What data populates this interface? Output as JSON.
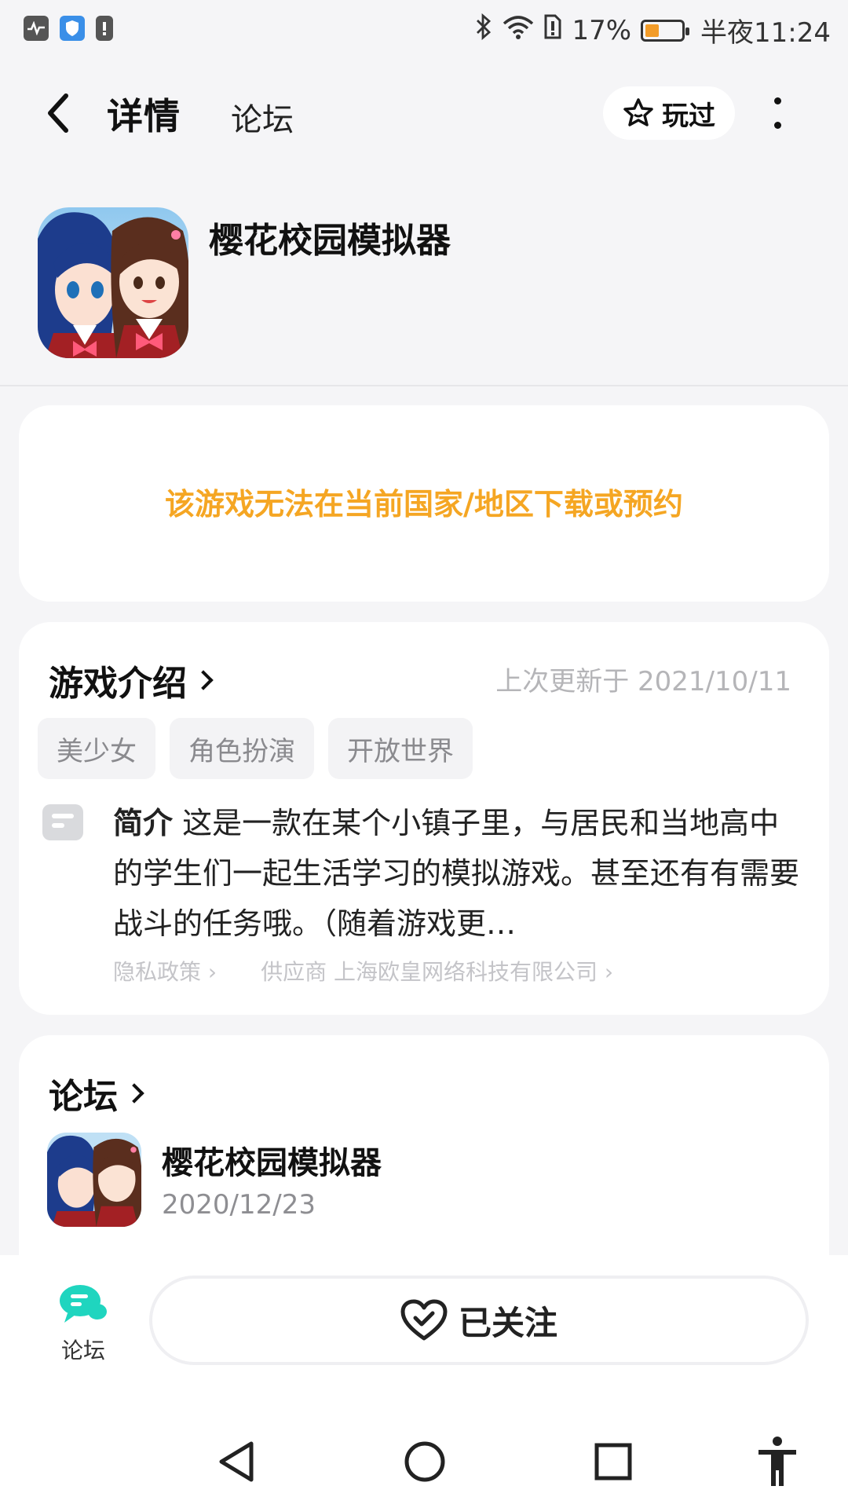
{
  "status_bar": {
    "battery_percent": "17%",
    "time": "半夜11:24",
    "icons": [
      "activity-monitor-icon",
      "shield-icon",
      "alert-icon",
      "bluetooth-icon",
      "wifi-icon",
      "sim-alert-icon",
      "battery-icon"
    ],
    "battery_level": 0.34
  },
  "header": {
    "tabs": [
      {
        "label": "详情",
        "active": true
      },
      {
        "label": "论坛",
        "active": false
      }
    ],
    "played_label": "玩过"
  },
  "app": {
    "title": "樱花校园模拟器"
  },
  "notice": {
    "text": "该游戏无法在当前国家/地区下载或预约",
    "color": "#f5a623"
  },
  "intro": {
    "title": "游戏介绍",
    "updated": "上次更新于 2021/10/11",
    "tags": [
      "美少女",
      "角色扮演",
      "开放世界"
    ],
    "summary_label": "简介",
    "summary": "这是一款在某个小镇子里，与居民和当地高中的学生们一起生活学习的模拟游戏。甚至还有有需要战斗的任务哦。（随着游戏更…",
    "privacy_label": "隐私政策",
    "supplier_label": "供应商 上海欧皇网络科技有限公司"
  },
  "forum": {
    "title": "论坛",
    "name": "樱花校园模拟器",
    "date": "2020/12/23"
  },
  "bottom": {
    "forum_label": "论坛",
    "follow_label": "已关注",
    "accent": "#1fd5bf"
  }
}
